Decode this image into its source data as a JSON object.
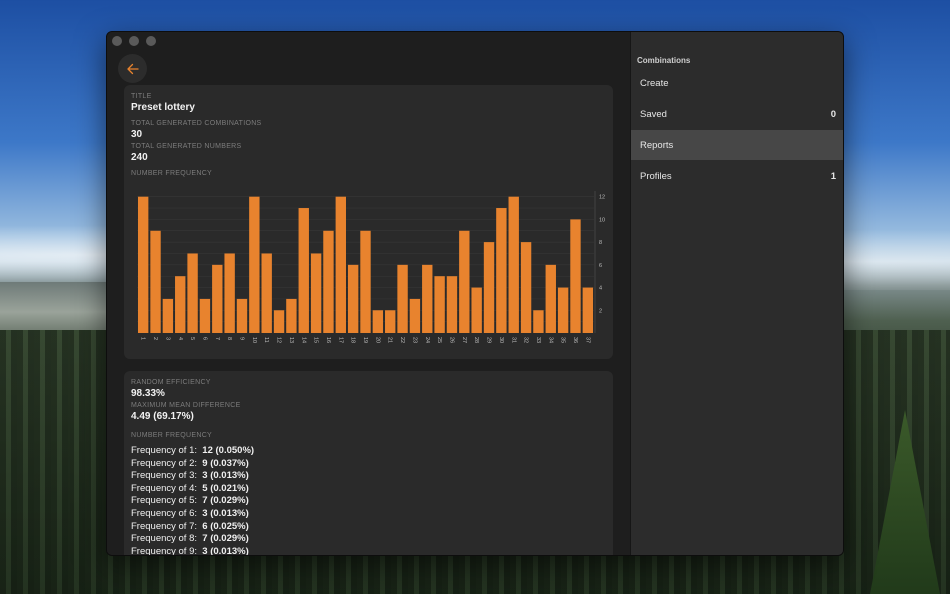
{
  "window": {
    "accent": "#e8832e"
  },
  "report": {
    "title_label": "TITLE",
    "title": "Preset lottery",
    "combos_label": "TOTAL GENERATED COMBINATIONS",
    "combos": "30",
    "numbers_label": "TOTAL GENERATED NUMBERS",
    "numbers": "240",
    "freq_label": "NUMBER FREQUENCY"
  },
  "chart_data": {
    "type": "bar",
    "categories": [
      "1",
      "2",
      "3",
      "4",
      "5",
      "6",
      "7",
      "8",
      "9",
      "10",
      "11",
      "12",
      "13",
      "14",
      "15",
      "16",
      "17",
      "18",
      "19",
      "20",
      "21",
      "22",
      "23",
      "24",
      "25",
      "26",
      "27",
      "28",
      "29",
      "30",
      "31",
      "32",
      "33",
      "34",
      "35",
      "36",
      "37"
    ],
    "values": [
      12,
      9,
      3,
      5,
      7,
      3,
      6,
      7,
      3,
      12,
      7,
      2,
      3,
      11,
      7,
      9,
      12,
      6,
      9,
      2,
      2,
      6,
      3,
      6,
      5,
      5,
      9,
      4,
      8,
      11,
      12,
      8,
      2,
      6,
      4,
      10,
      4
    ],
    "y_ticks": [
      "2",
      "4",
      "6",
      "8",
      "10",
      "12"
    ],
    "ylim": [
      0,
      12.5
    ],
    "grid": true,
    "color": "#e8832e"
  },
  "stats": {
    "efficiency_label": "RANDOM EFFICIENCY",
    "efficiency": "98.33%",
    "mean_label": "MAXIMUM MEAN DIFFERENCE",
    "mean": "4.49 (69.17%)",
    "freq_label": "NUMBER FREQUENCY",
    "rows": [
      {
        "label": "Frequency of 1:",
        "value": "12 (0.050%)"
      },
      {
        "label": "Frequency of 2:",
        "value": "9 (0.037%)"
      },
      {
        "label": "Frequency of 3:",
        "value": "3 (0.013%)"
      },
      {
        "label": "Frequency of 4:",
        "value": "5 (0.021%)"
      },
      {
        "label": "Frequency of 5:",
        "value": "7 (0.029%)"
      },
      {
        "label": "Frequency of 6:",
        "value": "3 (0.013%)"
      },
      {
        "label": "Frequency of 7:",
        "value": "6 (0.025%)"
      },
      {
        "label": "Frequency of 8:",
        "value": "7 (0.029%)"
      },
      {
        "label": "Frequency of 9:",
        "value": "3 (0.013%)"
      }
    ]
  },
  "sidebar": {
    "heading": "Combinations",
    "items": [
      {
        "label": "Create",
        "count": ""
      },
      {
        "label": "Saved",
        "count": "0"
      },
      {
        "label": "Reports",
        "count": ""
      },
      {
        "label": "Profiles",
        "count": "1"
      }
    ]
  }
}
